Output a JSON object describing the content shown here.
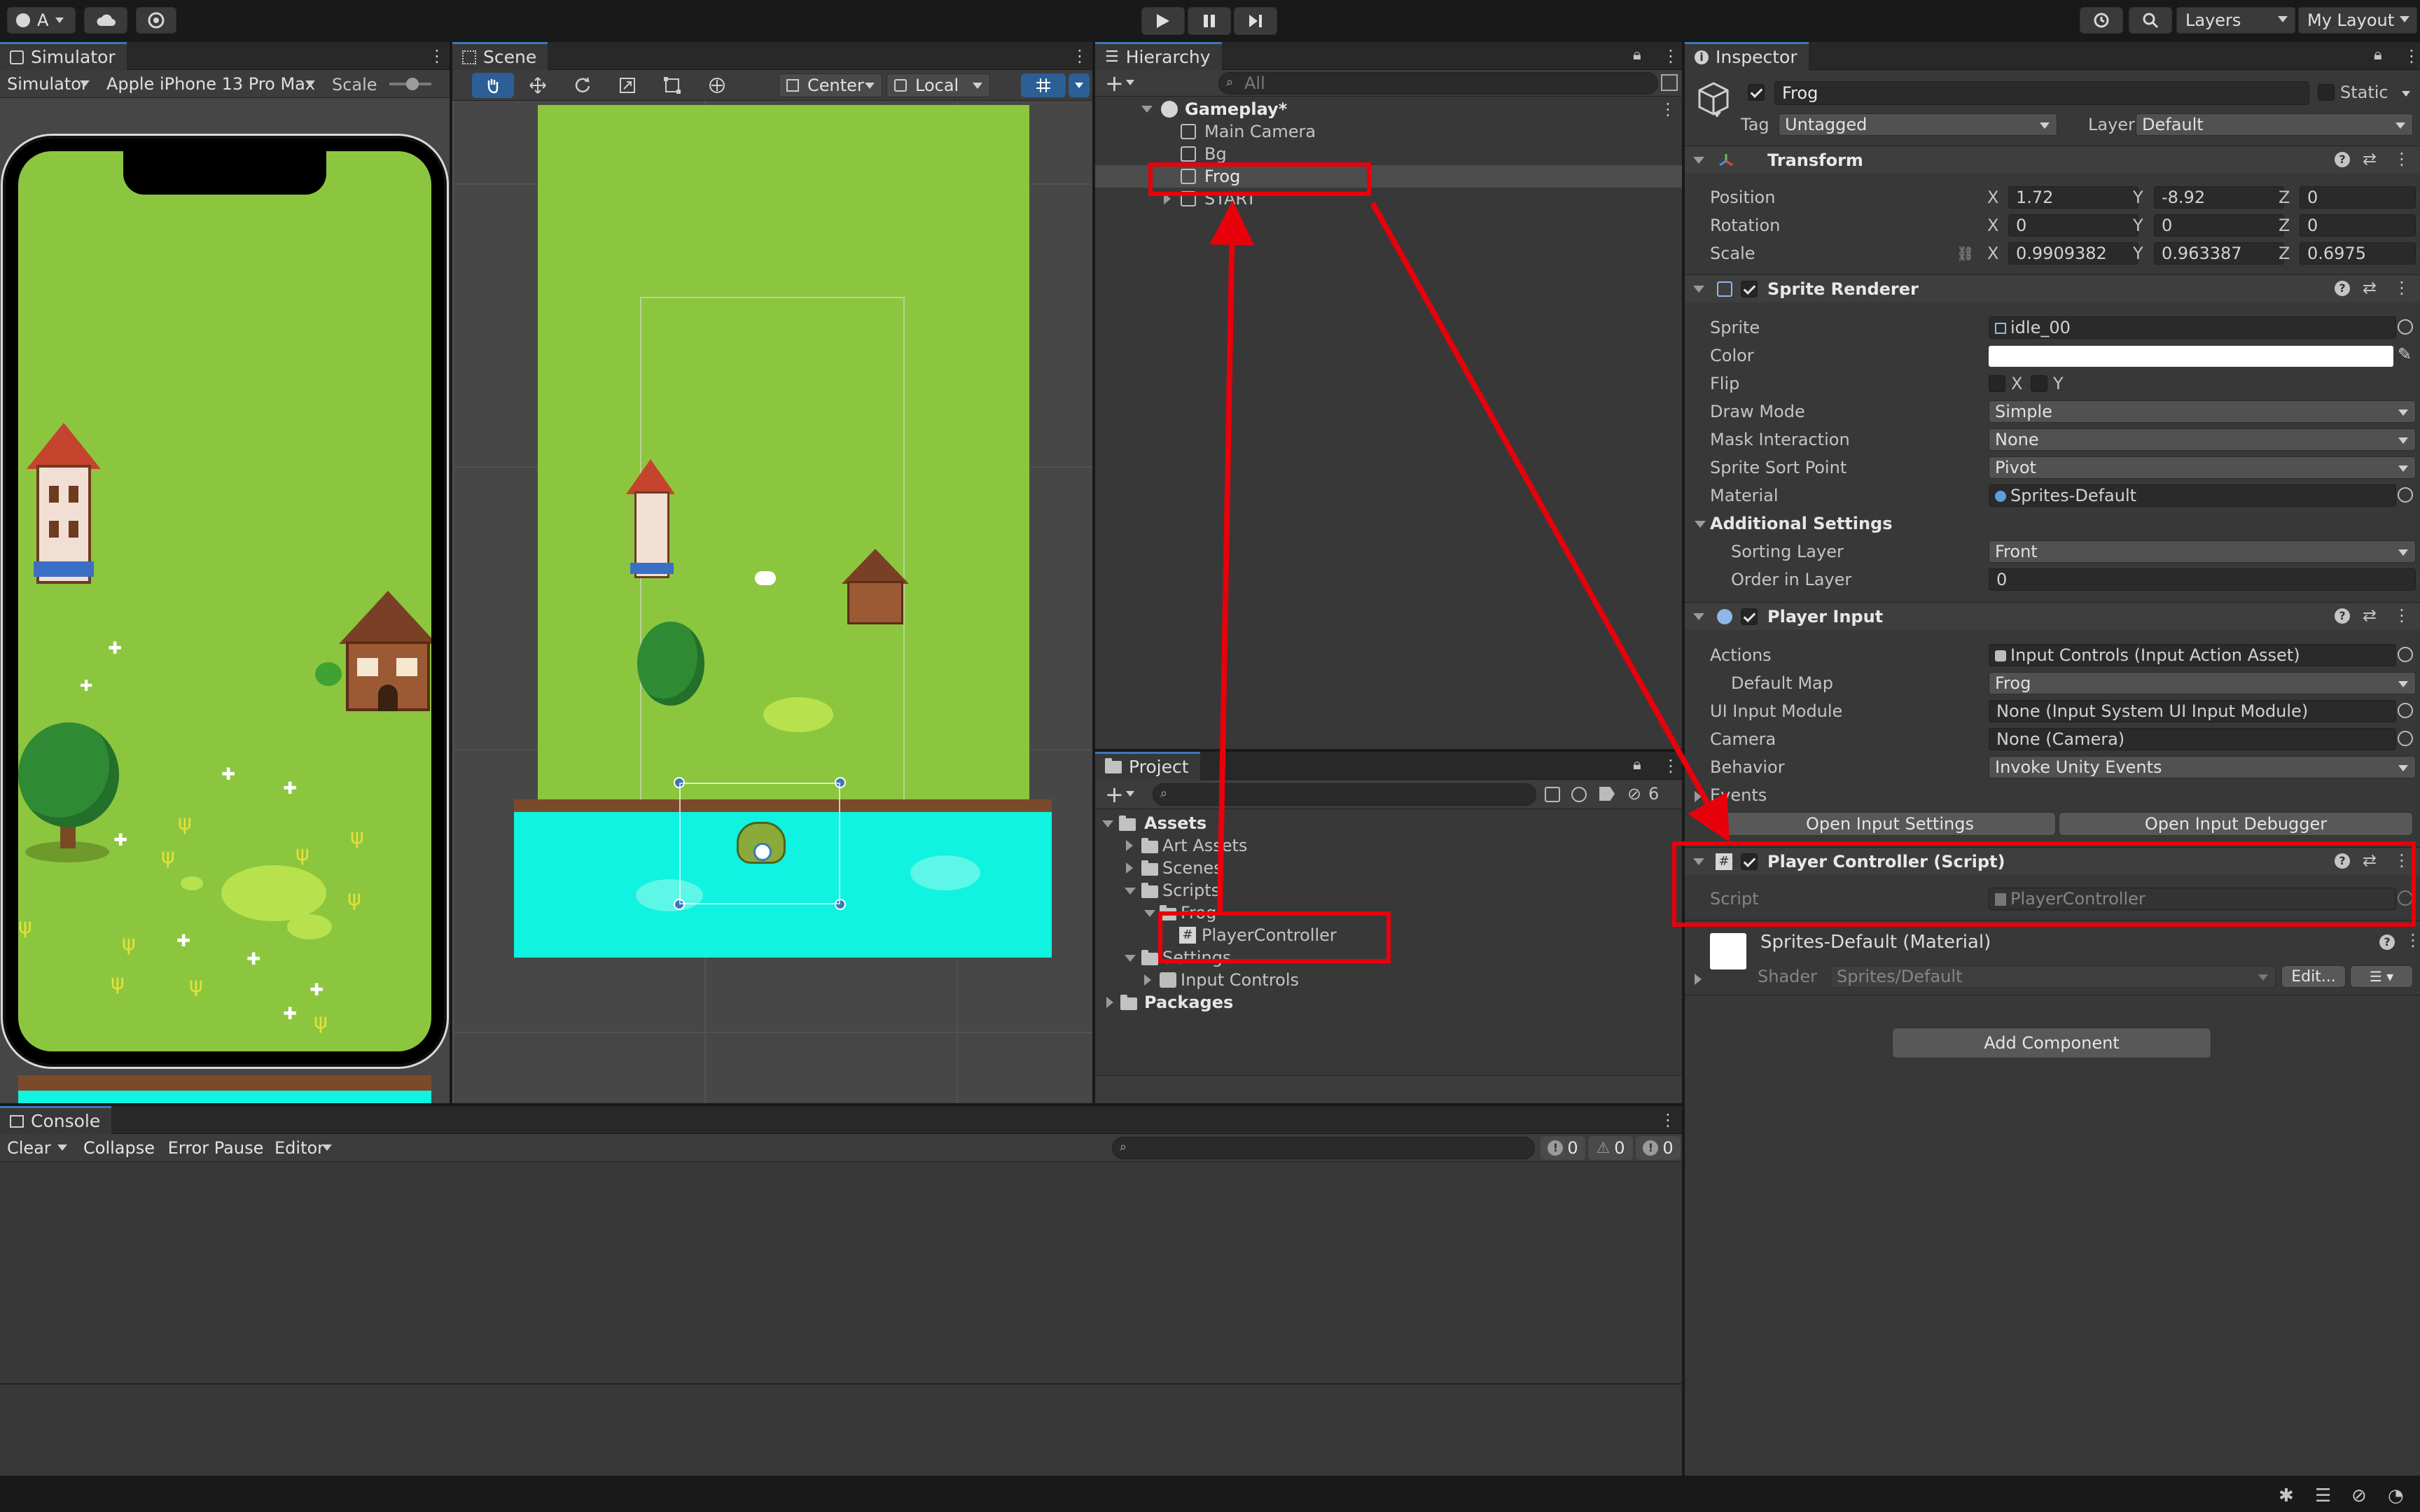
{
  "topbar": {
    "account_label": "A",
    "layers_label": "Layers",
    "layout_label": "My Layout"
  },
  "simulator": {
    "tab_label": "Simulator",
    "mode_label": "Simulator",
    "device_label": "Apple iPhone 13 Pro Max",
    "scale_label": "Scale"
  },
  "scene": {
    "tab_label": "Scene",
    "pivot_label": "Center",
    "space_label": "Local"
  },
  "hierarchy": {
    "tab_label": "Hierarchy",
    "search_placeholder": "All",
    "root": "Gameplay*",
    "items": [
      "Main Camera",
      "Bg",
      "Frog",
      "START"
    ]
  },
  "project": {
    "tab_label": "Project",
    "hidden_count": "6",
    "tree": {
      "assets": "Assets",
      "art_assets": "Art Assets",
      "scenes": "Scenes",
      "scripts": "Scripts",
      "frog": "Frog",
      "player_controller": "PlayerController",
      "settings": "Settings",
      "input_controls": "Input Controls",
      "packages": "Packages"
    }
  },
  "console": {
    "tab_label": "Console",
    "clear": "Clear",
    "collapse": "Collapse",
    "error_pause": "Error Pause",
    "editor": "Editor",
    "log_count": "0",
    "warn_count": "0",
    "error_count": "0"
  },
  "inspector": {
    "tab_label": "Inspector",
    "object_name": "Frog",
    "static_label": "Static",
    "tag_label": "Tag",
    "tag_value": "Untagged",
    "layer_label": "Layer",
    "layer_value": "Default",
    "transform": {
      "title": "Transform",
      "position_label": "Position",
      "rotation_label": "Rotation",
      "scale_label": "Scale",
      "pos": {
        "x": "1.72",
        "y": "-8.92",
        "z": "0"
      },
      "rot": {
        "x": "0",
        "y": "0",
        "z": "0"
      },
      "scale": {
        "x": "0.9909382",
        "y": "0.963387",
        "z": "0.6975"
      }
    },
    "sprite_renderer": {
      "title": "Sprite Renderer",
      "sprite_label": "Sprite",
      "sprite_value": "idle_00",
      "color_label": "Color",
      "flip_label": "Flip",
      "flip_x": "X",
      "flip_y": "Y",
      "draw_mode_label": "Draw Mode",
      "draw_mode_value": "Simple",
      "mask_label": "Mask Interaction",
      "mask_value": "None",
      "sort_point_label": "Sprite Sort Point",
      "sort_point_value": "Pivot",
      "material_label": "Material",
      "material_value": "Sprites-Default",
      "additional_label": "Additional Settings",
      "sorting_layer_label": "Sorting Layer",
      "sorting_layer_value": "Front",
      "order_label": "Order in Layer",
      "order_value": "0"
    },
    "player_input": {
      "title": "Player Input",
      "actions_label": "Actions",
      "actions_value": "Input Controls (Input Action Asset)",
      "default_map_label": "Default Map",
      "default_map_value": "Frog",
      "ui_module_label": "UI Input Module",
      "ui_module_value": "None (Input System UI Input Module)",
      "camera_label": "Camera",
      "camera_value": "None (Camera)",
      "behavior_label": "Behavior",
      "behavior_value": "Invoke Unity Events",
      "events_label": "Events",
      "open_settings": "Open Input Settings",
      "open_debugger": "Open Input Debugger"
    },
    "player_controller": {
      "title": "Player Controller (Script)",
      "script_label": "Script",
      "script_value": "PlayerController"
    },
    "material": {
      "title": "Sprites-Default (Material)",
      "shader_label": "Shader",
      "shader_value": "Sprites/Default",
      "edit_label": "Edit..."
    },
    "add_component": "Add Component"
  },
  "colors": {
    "grass": "#8cc63f",
    "water": "#0ff3e0",
    "highlight_red": "#e8000b",
    "selection": "#4d4d4d"
  }
}
